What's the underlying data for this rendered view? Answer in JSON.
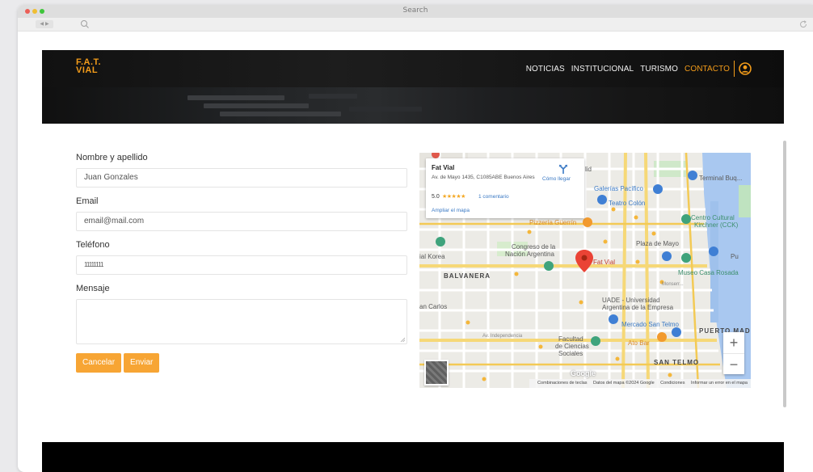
{
  "browser": {
    "title": "Search",
    "nav_glyph": "◀ ▶"
  },
  "header": {
    "logo_line1": "F.A.T.",
    "logo_line2": "VIAL",
    "nav": [
      {
        "label": "NOTICIAS"
      },
      {
        "label": "INSTITUCIONAL"
      },
      {
        "label": "TURISMO"
      },
      {
        "label": "CONTACTO",
        "active": true
      }
    ],
    "accent_color": "#f39c1a"
  },
  "form": {
    "name_label": "Nombre y apellido",
    "name_value": "Juan Gonzales",
    "email_label": "Email",
    "email_value": "email@mail.com",
    "phone_label": "Teléfono",
    "phone_value": "11111111",
    "message_label": "Mensaje",
    "message_value": "",
    "cancel_label": "Cancelar",
    "send_label": "Enviar",
    "button_color": "#f7a534"
  },
  "map": {
    "place_name": "Fat Vial",
    "address": "Av. de Mayo 1435, C1085ABE Buenos Aires",
    "rating": "5.0",
    "stars": "★★★★★",
    "reviews": "1 comentario",
    "directions": "Cómo llegar",
    "enlarge": "Ampliar el mapa",
    "pin_label": "Fat Vial",
    "zoom_in": "+",
    "zoom_out": "−",
    "google": "Google",
    "attribution": {
      "shortcuts": "Combinaciones de teclas",
      "data": "Datos del mapa ©2024 Google",
      "terms": "Condiciones",
      "report": "Informar un error en el mapa"
    },
    "labels": {
      "galerias": "Galerías Pacífico",
      "teatro": "Teatro Colón",
      "terminal": "Terminal Buq...",
      "centro": "Centro Cultural",
      "kirchner": "Kirchner (CCK)",
      "guerrin": "Pizzería Güerrín",
      "plaza": "Plaza de Mayo",
      "congreso1": "Congreso de la",
      "congreso2": "Nación Argentina",
      "koreatown": "ial Korea",
      "balvanera": "BALVANERA",
      "casa_rosada": "Museo Casa Rosada",
      "san_carlos": "an Carlos",
      "uade1": "UADE - Universidad",
      "uade2": "Argentina de la Empresa",
      "mercado": "Mercado San Telmo",
      "puerto": "PUERTO MAD",
      "facultad1": "Facultad",
      "facultad2": "de Ciencias",
      "facultad3": "Sociales",
      "ato_bar": "Ato Bar",
      "san_telmo": "SAN TELMO",
      "independencia": "Av. Independencia",
      "lid": "lid",
      "pu": "Pu",
      "monserrat": "Monserr..."
    }
  }
}
